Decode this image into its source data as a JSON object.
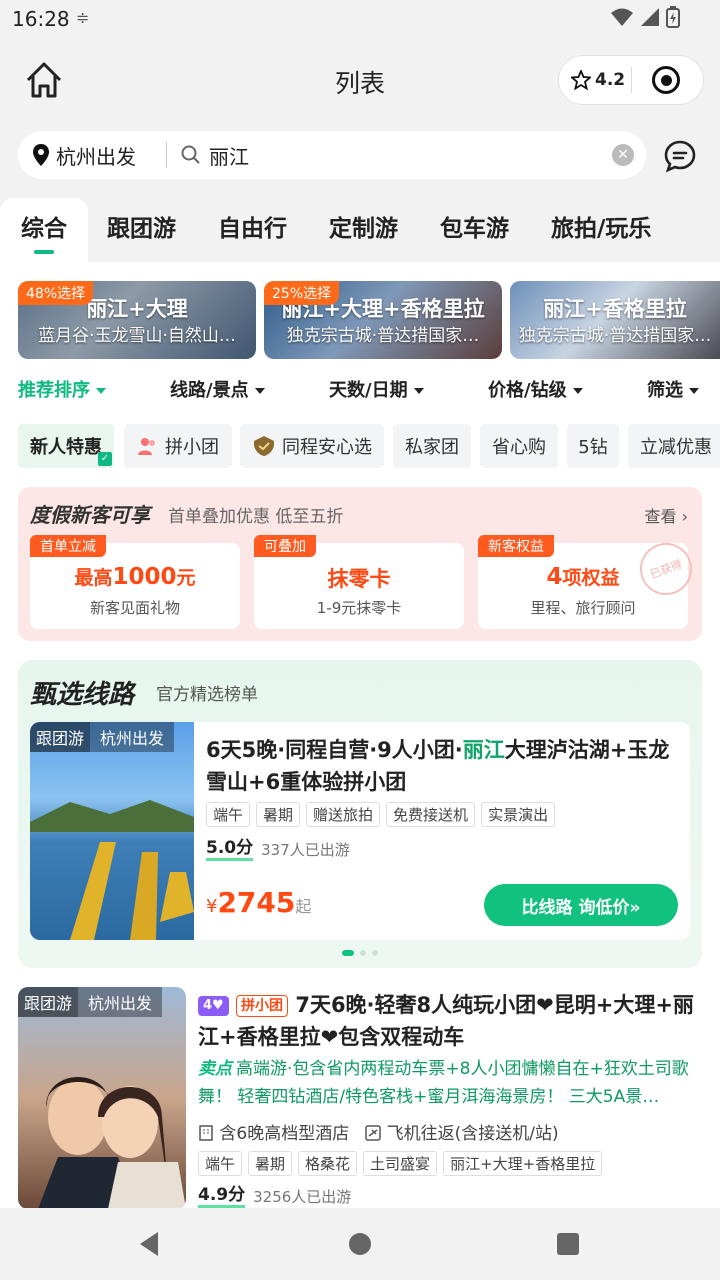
{
  "status": {
    "time": "16:28"
  },
  "header": {
    "title": "列表",
    "rating": "4.2"
  },
  "search": {
    "origin": "杭州出发",
    "query": "丽江"
  },
  "tabs": [
    "综合",
    "跟团游",
    "自由行",
    "定制游",
    "包车游",
    "旅拍/玩乐"
  ],
  "banners": [
    {
      "badge": "48%选择",
      "title": "丽江+大理",
      "subtitle": "蓝月谷·玉龙雪山·自然山…"
    },
    {
      "badge": "25%选择",
      "title": "丽江+大理+香格里拉",
      "subtitle": "独克宗古城·普达措国家…"
    },
    {
      "title": "丽江+香格里拉",
      "subtitle": "独克宗古城·普达措国家…"
    }
  ],
  "sort": [
    "推荐排序",
    "线路/景点",
    "天数/日期",
    "价格/钻级",
    "筛选"
  ],
  "chips": [
    "新人特惠",
    "拼小团",
    "同程安心选",
    "私家团",
    "省心购",
    "5钻",
    "立减优惠"
  ],
  "promo": {
    "title": "度假新客可享",
    "subtitle": "首单叠加优惠 低至五折",
    "more": "查看",
    "stamp": "已获得",
    "cards": [
      {
        "tag": "首单立减",
        "prefix": "最高",
        "value": "1000",
        "suffix": "元",
        "desc": "新客见面礼物"
      },
      {
        "tag": "可叠加",
        "prefix": "",
        "value": "抹零卡",
        "suffix": "",
        "desc": "1-9元抹零卡"
      },
      {
        "tag": "新客权益",
        "prefix": "",
        "value": "4",
        "suffix": "项权益",
        "desc": "里程、旅行顾问"
      }
    ]
  },
  "featured": {
    "title": "甄选线路",
    "subtitle": "官方精选榜单",
    "card": {
      "type": "跟团游",
      "origin": "杭州出发",
      "name_pre": "6天5晚·同程自营·9人小团·",
      "name_hl": "丽江",
      "name_post": "大理泸沽湖+玉龙雪山+6重体验拼小团",
      "tags": [
        "端午",
        "暑期",
        "赠送旅拍",
        "免费接送机",
        "实景演出"
      ],
      "score": "5.0分",
      "sold": "337人已出游",
      "price_symbol": "¥",
      "price": "2745",
      "price_suffix": "起",
      "cta": "比线路 询低价»"
    }
  },
  "item2": {
    "type": "跟团游",
    "origin": "杭州出发",
    "level": "4",
    "badge": "拼小团",
    "title": "7天6晚·轻奢8人纯玩小团❤昆明+大理+丽江+香格里拉❤包含双程动车",
    "sell_label": "卖点",
    "sell_text": "高端游·包含省内两程动车票+8人小团慵懒自在+狂欢土司歌舞！ 轻奢四钻酒店/特色客栈+蜜月洱海海景房！ 三大5A景…",
    "hotel": "含6晚高档型酒店",
    "transport": "飞机往返(含接送机/站)",
    "tags": [
      "端午",
      "暑期",
      "格桑花",
      "土司盛宴",
      "丽江+大理+香格里拉"
    ],
    "score": "4.9分",
    "sold": "3256人已出游"
  },
  "colors": {
    "accent": "#10b981",
    "price": "#ff4a14",
    "promo_bg": "#fde7e6"
  }
}
